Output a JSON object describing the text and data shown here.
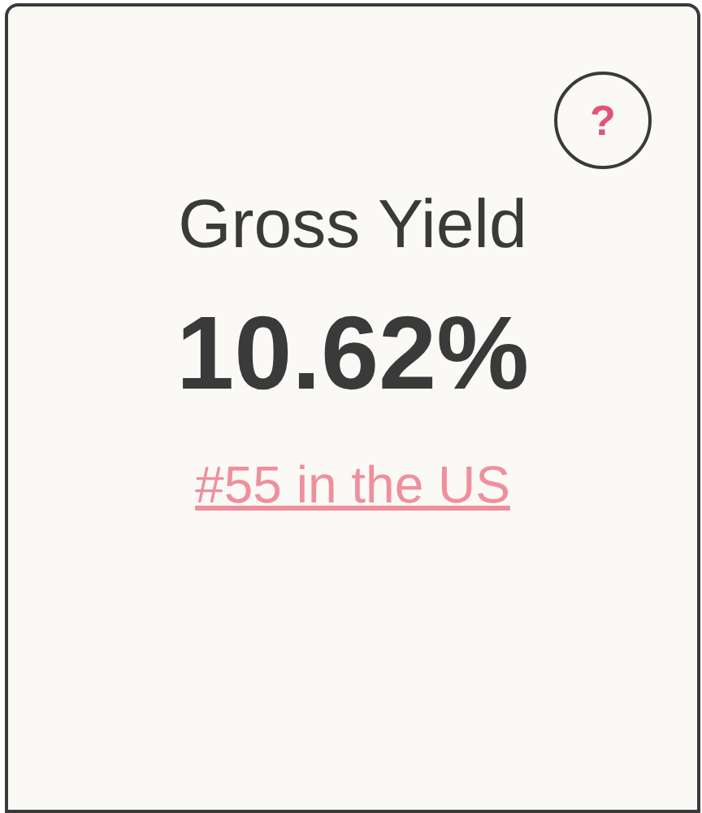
{
  "card": {
    "help_button": {
      "label": "?"
    },
    "title": "Gross Yield",
    "value": "10.62%",
    "rank_link": "#55 in the US"
  }
}
